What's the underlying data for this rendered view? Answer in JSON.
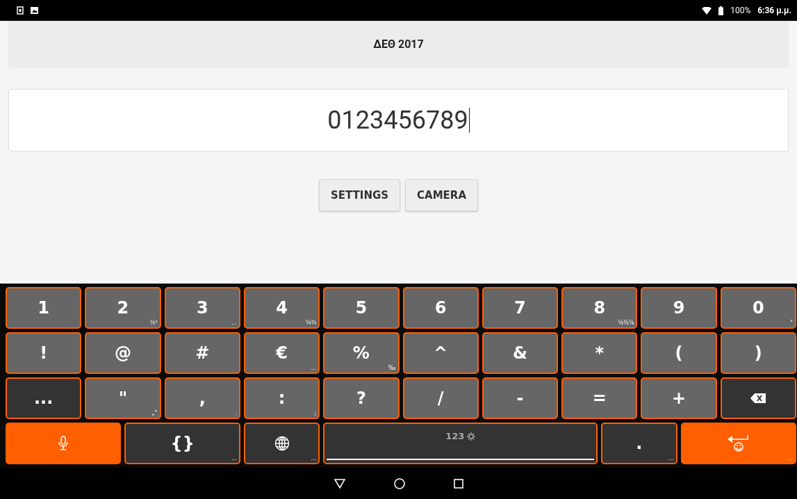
{
  "status_bar": {
    "battery": "100%",
    "time": "6:36 μ.μ."
  },
  "app_bar": {
    "title": "ΔΕΘ 2017"
  },
  "input": {
    "value": "0123456789"
  },
  "buttons": [
    "SETTINGS",
    "CAMERA"
  ],
  "keyboard": {
    "rows": [
      {
        "keys": [
          {
            "label": "1",
            "kind": "char"
          },
          {
            "label": "2",
            "hint": "½²",
            "kind": "char"
          },
          {
            "label": "3",
            "hint": "...",
            "kind": "char"
          },
          {
            "label": "4",
            "hint": "¼¾",
            "kind": "char"
          },
          {
            "label": "5",
            "kind": "char"
          },
          {
            "label": "6",
            "kind": "char"
          },
          {
            "label": "7",
            "kind": "char"
          },
          {
            "label": "8",
            "hint": "⅛⅜⅞",
            "kind": "char"
          },
          {
            "label": "9",
            "kind": "char"
          },
          {
            "label": "0",
            "hint": "°",
            "kind": "char"
          }
        ]
      },
      {
        "keys": [
          {
            "label": "!",
            "kind": "char"
          },
          {
            "label": "@",
            "kind": "char"
          },
          {
            "label": "#",
            "kind": "char"
          },
          {
            "label": "€",
            "hint": "...",
            "kind": "char"
          },
          {
            "label": "%",
            "hint": "‰",
            "kind": "char"
          },
          {
            "label": "^",
            "kind": "char"
          },
          {
            "label": "&",
            "kind": "char"
          },
          {
            "label": "*",
            "kind": "char"
          },
          {
            "label": "(",
            "kind": "char"
          },
          {
            "label": ")",
            "kind": "char"
          }
        ]
      },
      {
        "keys": [
          {
            "label": "...",
            "kind": "function"
          },
          {
            "label": "\"",
            "hint": "„“",
            "kind": "char"
          },
          {
            "label": ",",
            "hint": ".",
            "kind": "char"
          },
          {
            "label": ":",
            "hint": ";",
            "kind": "char"
          },
          {
            "label": "?",
            "kind": "char"
          },
          {
            "label": "/",
            "kind": "char"
          },
          {
            "label": "-",
            "kind": "char"
          },
          {
            "label": "=",
            "kind": "char"
          },
          {
            "label": "+",
            "kind": "char"
          },
          {
            "kind": "backspace"
          }
        ]
      },
      {
        "keys": [
          {
            "kind": "mic"
          },
          {
            "label": "{}",
            "hint": "...",
            "kind": "function"
          },
          {
            "hint": "...",
            "kind": "globe"
          },
          {
            "label": "123",
            "kind": "space"
          },
          {
            "label": ".",
            "hint": "...",
            "kind": "function"
          },
          {
            "hint": "...",
            "kind": "enter"
          }
        ]
      }
    ]
  }
}
